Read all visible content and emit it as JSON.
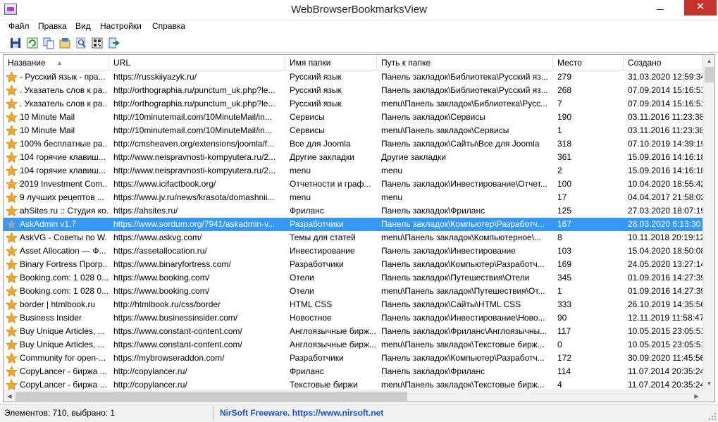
{
  "window": {
    "title": "WebBrowserBookmarksView"
  },
  "menu": [
    {
      "label": "Файл"
    },
    {
      "label": "Правка"
    },
    {
      "label": "Вид"
    },
    {
      "label": "Настройки"
    },
    {
      "label": "Справка"
    }
  ],
  "toolbar": [
    {
      "icon": "save-icon"
    },
    {
      "icon": "refresh-icon"
    },
    {
      "icon": "copy-icon"
    },
    {
      "icon": "properties-icon"
    },
    {
      "icon": "find-icon"
    },
    {
      "icon": "html-report-icon"
    },
    {
      "icon": "exit-icon"
    }
  ],
  "columns": [
    {
      "label": "Название"
    },
    {
      "label": "URL"
    },
    {
      "label": "Имя папки"
    },
    {
      "label": "Путь к папке"
    },
    {
      "label": "Место"
    },
    {
      "label": "Создано"
    }
  ],
  "rows": [
    {
      "name": "- Русский язык - пра...",
      "url": "https://russkiiyazyk.ru/",
      "folder": "Русский язык",
      "path": "Панель закладок\\Библиотека\\Русский яз...",
      "pos": "279",
      "created": "31.03.2020 12:59:34"
    },
    {
      "name": ". Указатель слов к ра...",
      "url": "http://orthographia.ru/punctum_uk.php?le...",
      "folder": "Русский язык",
      "path": "Панель закладок\\Библиотека\\Русский яз...",
      "pos": "268",
      "created": "07.09.2014 15:16:51"
    },
    {
      "name": ". Указатель слов к ра...",
      "url": "http://orthographia.ru/punctum_uk.php?le...",
      "folder": "Русский язык",
      "path": "menu\\Панель закладок\\Библиотека\\Русс...",
      "pos": "7",
      "created": "07.09.2014 15:16:51"
    },
    {
      "name": "10 Minute Mail",
      "url": "http://10minutemail.com/10MinuteMail/in...",
      "folder": "Сервисы",
      "path": "Панель закладок\\Сервисы",
      "pos": "190",
      "created": "03.11.2016 11:23:38"
    },
    {
      "name": "10 Minute Mail",
      "url": "http://10minutemail.com/10MinuteMail/in...",
      "folder": "Сервисы",
      "path": "menu\\Панель закладок\\Сервисы",
      "pos": "1",
      "created": "03.11.2016 11:23:38"
    },
    {
      "name": "100% бесплатные ра...",
      "url": "http://cmsheaven.org/extensions/joomla/f...",
      "folder": "Все для Joomla",
      "path": "Панель закладок\\Сайты\\Все для Joomla",
      "pos": "318",
      "created": "07.10.2019 14:39:19"
    },
    {
      "name": "104 горячие клавиш...",
      "url": "http://www.neispravnosti-kompyutera.ru/2...",
      "folder": "Другие закладки",
      "path": "Другие закладки",
      "pos": "361",
      "created": "15.09.2016 14:16:18"
    },
    {
      "name": "104 горячие клавиш...",
      "url": "http://www.neispravnosti-kompyutera.ru/2...",
      "folder": "menu",
      "path": "menu",
      "pos": "2",
      "created": "15.09.2016 14:16:18"
    },
    {
      "name": "2019 Investment Com...",
      "url": "https://www.icifactbook.org/",
      "folder": "Отчетности и граф...",
      "path": "Панель закладок\\Инвестирование\\Отчет...",
      "pos": "100",
      "created": "10.04.2020 18:55:42"
    },
    {
      "name": "9 лучших рецептов ...",
      "url": "https://www.jv.ru/news/krasota/domashnii...",
      "folder": "menu",
      "path": "menu",
      "pos": "17",
      "created": "04.04.2017 21:58:02"
    },
    {
      "name": "ahSites.ru :: Студия ко...",
      "url": "https://ahsites.ru/",
      "folder": "Фриланс",
      "path": "Панель закладок\\Фриланс",
      "pos": "125",
      "created": "27.03.2020 18:07:19"
    },
    {
      "name": "AskAdmin v1.7",
      "url": "https://www.sordum.org/7941/askadmin-v...",
      "folder": "Разработчики",
      "path": "Панель закладок\\Компьютер\\Разработч...",
      "pos": "167",
      "created": "28.03.2020 6:13:30"
    },
    {
      "name": "AskVG - Советы по W...",
      "url": "https://www.askvg.com/",
      "folder": "Темы для статей",
      "path": "menu\\Панель закладок\\Компьютерное\\...",
      "pos": "8",
      "created": "10.11.2018 20:19:12"
    },
    {
      "name": "Asset Allocation — Ф...",
      "url": "https://assetallocation.ru/",
      "folder": "Инвестирование",
      "path": "Панель закладок\\Инвестирование",
      "pos": "103",
      "created": "15.04.2020 18:50:08"
    },
    {
      "name": "Binary Fortress Прогр...",
      "url": "https://www.binaryfortress.com/",
      "folder": "Разработчики",
      "path": "Панель закладок\\Компьютер\\Разработч...",
      "pos": "169",
      "created": "24.05.2020 13:27:14"
    },
    {
      "name": "Booking.com: 1 028 0...",
      "url": "https://www.booking.com/",
      "folder": "Отели",
      "path": "Панель закладок\\Путешествия\\Отели",
      "pos": "345",
      "created": "01.09.2016 14:27:39"
    },
    {
      "name": "Booking.com: 1 028 0...",
      "url": "https://www.booking.com/",
      "folder": "Отели",
      "path": "menu\\Панель закладок\\Путешествия\\От...",
      "pos": "1",
      "created": "01.09.2016 14:27:39"
    },
    {
      "name": "border | htmlbook.ru",
      "url": "http://htmlbook.ru/css/border",
      "folder": "HTML CSS",
      "path": "Панель закладок\\Сайты\\HTML CSS",
      "pos": "333",
      "created": "26.10.2019 14:35:56"
    },
    {
      "name": "Business Insider",
      "url": "https://www.businessinsider.com/",
      "folder": "Новостное",
      "path": "Панель закладок\\Инвестирование\\Ново...",
      "pos": "90",
      "created": "12.11.2019 11:58:47"
    },
    {
      "name": "Buy Unique Articles, ...",
      "url": "https://www.constant-content.com/",
      "folder": "Англоязычные бирж...",
      "path": "Панель закладок\\Фриланс\\Англоязычны...",
      "pos": "117",
      "created": "10.05.2015 23:05:51"
    },
    {
      "name": "Buy Unique Articles, ...",
      "url": "https://www.constant-content.com/",
      "folder": "Англоязычные бирж...",
      "path": "menu\\Панель закладок\\Текстовые бирж...",
      "pos": "0",
      "created": "10.05.2015 23:05:51"
    },
    {
      "name": "Community for open-...",
      "url": "https://mybrowseraddon.com/",
      "folder": "Разработчики",
      "path": "Панель закладок\\Компьютер\\Разработч...",
      "pos": "172",
      "created": "30.09.2020 11:45:56"
    },
    {
      "name": "CopyLancer - биржа ...",
      "url": "http://copylancer.ru/",
      "folder": "Фриланс",
      "path": "Панель закладок\\Фриланс",
      "pos": "114",
      "created": "11.07.2014 20:35:24"
    },
    {
      "name": "CopyLancer - биржа ...",
      "url": "http://copylancer.ru/",
      "folder": "Текстовые биржи",
      "path": "menu\\Панель закладок\\Текстовые бирж...",
      "pos": "4",
      "created": "11.07.2014 20:35:24"
    }
  ],
  "selected_row": 11,
  "status": {
    "left": "Элементов: 710, выбрано: 1",
    "right": "NirSoft Freeware. https://www.nirsoft.net"
  },
  "colors": {
    "selection": "#3399ff",
    "star": "#f5a623",
    "star_selected": "#8fa7c2",
    "link": "#1a4fd8"
  }
}
